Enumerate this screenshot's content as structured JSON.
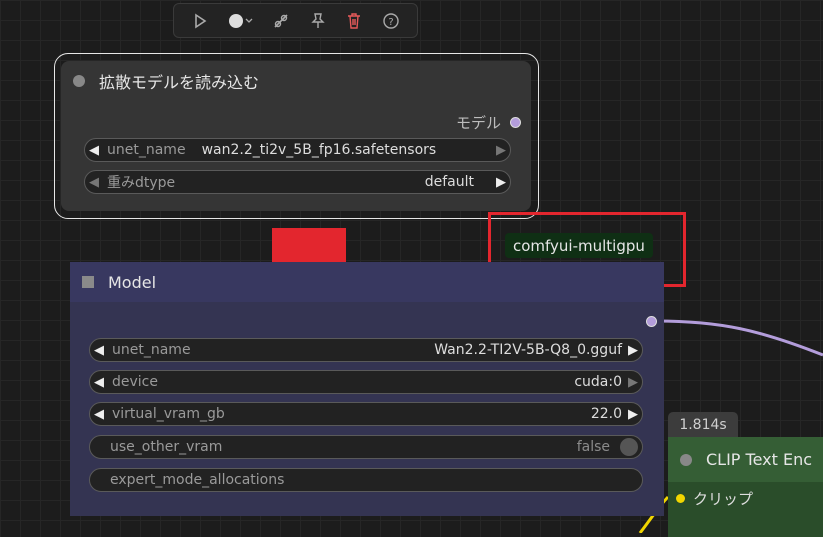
{
  "toolbar": {
    "icons": [
      "play-icon",
      "color-circle-icon",
      "bypass-icon",
      "pin-icon",
      "delete-icon",
      "help-icon"
    ]
  },
  "node_load": {
    "title": "拡散モデルを読み込む",
    "output_label": "モデル",
    "widgets": [
      {
        "name": "unet_name",
        "value": "wan2.2_ti2v_5B_fp16.safetensors"
      },
      {
        "name": "重みdtype",
        "value": "default"
      }
    ]
  },
  "badge": {
    "text": "comfyui-multigpu"
  },
  "node_model": {
    "title": "Model",
    "widgets": [
      {
        "name": "unet_name",
        "value": "Wan2.2-TI2V-5B-Q8_0.gguf"
      },
      {
        "name": "device",
        "value": "cuda:0"
      },
      {
        "name": "virtual_vram_gb",
        "value": "22.0"
      },
      {
        "name": "use_other_vram",
        "value": "false"
      },
      {
        "name": "expert_mode_allocations",
        "value": ""
      }
    ]
  },
  "node_clip": {
    "time": "1.814s",
    "title": "CLIP Text Enc",
    "input_label": "クリップ"
  },
  "colors": {
    "accent_red": "#e3262e",
    "node_model_bg": "#2f2f52",
    "wire_purple": "#b39ddb",
    "clip_node_bg": "#2d5b2d"
  }
}
